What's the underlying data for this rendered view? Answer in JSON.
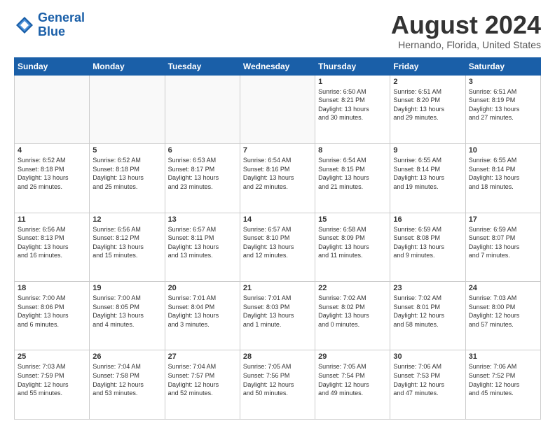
{
  "logo": {
    "line1": "General",
    "line2": "Blue"
  },
  "title": "August 2024",
  "subtitle": "Hernando, Florida, United States",
  "days_header": [
    "Sunday",
    "Monday",
    "Tuesday",
    "Wednesday",
    "Thursday",
    "Friday",
    "Saturday"
  ],
  "weeks": [
    [
      {
        "day": "",
        "info": ""
      },
      {
        "day": "",
        "info": ""
      },
      {
        "day": "",
        "info": ""
      },
      {
        "day": "",
        "info": ""
      },
      {
        "day": "1",
        "info": "Sunrise: 6:50 AM\nSunset: 8:21 PM\nDaylight: 13 hours\nand 30 minutes."
      },
      {
        "day": "2",
        "info": "Sunrise: 6:51 AM\nSunset: 8:20 PM\nDaylight: 13 hours\nand 29 minutes."
      },
      {
        "day": "3",
        "info": "Sunrise: 6:51 AM\nSunset: 8:19 PM\nDaylight: 13 hours\nand 27 minutes."
      }
    ],
    [
      {
        "day": "4",
        "info": "Sunrise: 6:52 AM\nSunset: 8:18 PM\nDaylight: 13 hours\nand 26 minutes."
      },
      {
        "day": "5",
        "info": "Sunrise: 6:52 AM\nSunset: 8:18 PM\nDaylight: 13 hours\nand 25 minutes."
      },
      {
        "day": "6",
        "info": "Sunrise: 6:53 AM\nSunset: 8:17 PM\nDaylight: 13 hours\nand 23 minutes."
      },
      {
        "day": "7",
        "info": "Sunrise: 6:54 AM\nSunset: 8:16 PM\nDaylight: 13 hours\nand 22 minutes."
      },
      {
        "day": "8",
        "info": "Sunrise: 6:54 AM\nSunset: 8:15 PM\nDaylight: 13 hours\nand 21 minutes."
      },
      {
        "day": "9",
        "info": "Sunrise: 6:55 AM\nSunset: 8:14 PM\nDaylight: 13 hours\nand 19 minutes."
      },
      {
        "day": "10",
        "info": "Sunrise: 6:55 AM\nSunset: 8:14 PM\nDaylight: 13 hours\nand 18 minutes."
      }
    ],
    [
      {
        "day": "11",
        "info": "Sunrise: 6:56 AM\nSunset: 8:13 PM\nDaylight: 13 hours\nand 16 minutes."
      },
      {
        "day": "12",
        "info": "Sunrise: 6:56 AM\nSunset: 8:12 PM\nDaylight: 13 hours\nand 15 minutes."
      },
      {
        "day": "13",
        "info": "Sunrise: 6:57 AM\nSunset: 8:11 PM\nDaylight: 13 hours\nand 13 minutes."
      },
      {
        "day": "14",
        "info": "Sunrise: 6:57 AM\nSunset: 8:10 PM\nDaylight: 13 hours\nand 12 minutes."
      },
      {
        "day": "15",
        "info": "Sunrise: 6:58 AM\nSunset: 8:09 PM\nDaylight: 13 hours\nand 11 minutes."
      },
      {
        "day": "16",
        "info": "Sunrise: 6:59 AM\nSunset: 8:08 PM\nDaylight: 13 hours\nand 9 minutes."
      },
      {
        "day": "17",
        "info": "Sunrise: 6:59 AM\nSunset: 8:07 PM\nDaylight: 13 hours\nand 7 minutes."
      }
    ],
    [
      {
        "day": "18",
        "info": "Sunrise: 7:00 AM\nSunset: 8:06 PM\nDaylight: 13 hours\nand 6 minutes."
      },
      {
        "day": "19",
        "info": "Sunrise: 7:00 AM\nSunset: 8:05 PM\nDaylight: 13 hours\nand 4 minutes."
      },
      {
        "day": "20",
        "info": "Sunrise: 7:01 AM\nSunset: 8:04 PM\nDaylight: 13 hours\nand 3 minutes."
      },
      {
        "day": "21",
        "info": "Sunrise: 7:01 AM\nSunset: 8:03 PM\nDaylight: 13 hours\nand 1 minute."
      },
      {
        "day": "22",
        "info": "Sunrise: 7:02 AM\nSunset: 8:02 PM\nDaylight: 13 hours\nand 0 minutes."
      },
      {
        "day": "23",
        "info": "Sunrise: 7:02 AM\nSunset: 8:01 PM\nDaylight: 12 hours\nand 58 minutes."
      },
      {
        "day": "24",
        "info": "Sunrise: 7:03 AM\nSunset: 8:00 PM\nDaylight: 12 hours\nand 57 minutes."
      }
    ],
    [
      {
        "day": "25",
        "info": "Sunrise: 7:03 AM\nSunset: 7:59 PM\nDaylight: 12 hours\nand 55 minutes."
      },
      {
        "day": "26",
        "info": "Sunrise: 7:04 AM\nSunset: 7:58 PM\nDaylight: 12 hours\nand 53 minutes."
      },
      {
        "day": "27",
        "info": "Sunrise: 7:04 AM\nSunset: 7:57 PM\nDaylight: 12 hours\nand 52 minutes."
      },
      {
        "day": "28",
        "info": "Sunrise: 7:05 AM\nSunset: 7:56 PM\nDaylight: 12 hours\nand 50 minutes."
      },
      {
        "day": "29",
        "info": "Sunrise: 7:05 AM\nSunset: 7:54 PM\nDaylight: 12 hours\nand 49 minutes."
      },
      {
        "day": "30",
        "info": "Sunrise: 7:06 AM\nSunset: 7:53 PM\nDaylight: 12 hours\nand 47 minutes."
      },
      {
        "day": "31",
        "info": "Sunrise: 7:06 AM\nSunset: 7:52 PM\nDaylight: 12 hours\nand 45 minutes."
      }
    ]
  ]
}
